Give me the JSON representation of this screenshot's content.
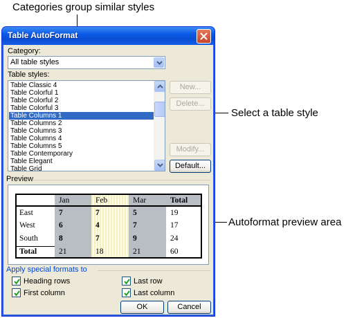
{
  "callouts": {
    "top": "Categories group similar styles",
    "right_style": "Select a table style",
    "right_preview": "Autoformat preview area"
  },
  "window": {
    "title": "Table AutoFormat",
    "close_icon": "close-icon"
  },
  "category": {
    "label": "Category:",
    "value": "All table styles"
  },
  "table_styles": {
    "label": "Table styles:",
    "items": [
      "Table Classic 4",
      "Table Colorful 1",
      "Table Colorful 2",
      "Table Colorful 3",
      "Table Columns 1",
      "Table Columns 2",
      "Table Columns 3",
      "Table Columns 4",
      "Table Columns 5",
      "Table Contemporary",
      "Table Elegant",
      "Table Grid"
    ],
    "selected": "Table Columns 1"
  },
  "buttons": {
    "new": "New...",
    "delete": "Delete...",
    "modify": "Modify...",
    "default": "Default...",
    "ok": "OK",
    "cancel": "Cancel"
  },
  "preview": {
    "label": "Preview",
    "headers": [
      "",
      "Jan",
      "Feb",
      "Mar",
      "Total"
    ],
    "rows": [
      [
        "East",
        "7",
        "7",
        "5",
        "19"
      ],
      [
        "West",
        "6",
        "4",
        "7",
        "17"
      ],
      [
        "South",
        "8",
        "7",
        "9",
        "24"
      ],
      [
        "Total",
        "21",
        "18",
        "21",
        "60"
      ]
    ]
  },
  "special_formats": {
    "label": "Apply special formats to",
    "heading_rows": "Heading rows",
    "first_column": "First column",
    "last_row": "Last row",
    "last_column": "Last column",
    "checked": {
      "heading_rows": true,
      "first_column": true,
      "last_row": true,
      "last_column": true
    }
  },
  "colors": {
    "title_bar": "#0a4fd4",
    "selection": "#316ac5",
    "dialog_bg": "#ece9d8",
    "shade_column": "#b8bec4",
    "feb_column": "#f4f2c4"
  }
}
